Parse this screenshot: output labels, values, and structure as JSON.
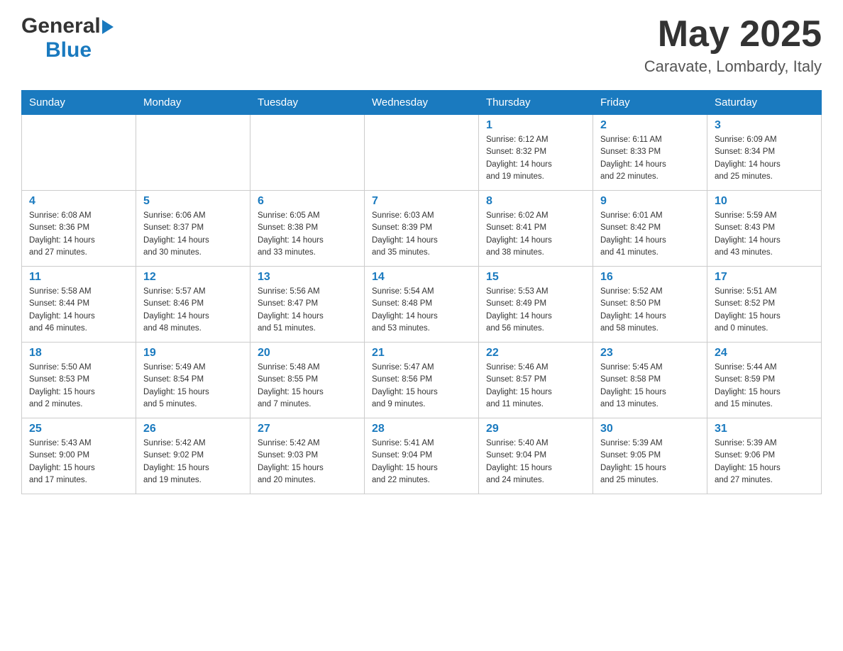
{
  "header": {
    "logo_general": "General",
    "logo_blue": "Blue",
    "month_year": "May 2025",
    "location": "Caravate, Lombardy, Italy"
  },
  "calendar": {
    "days_of_week": [
      "Sunday",
      "Monday",
      "Tuesday",
      "Wednesday",
      "Thursday",
      "Friday",
      "Saturday"
    ],
    "weeks": [
      [
        {
          "day": "",
          "info": ""
        },
        {
          "day": "",
          "info": ""
        },
        {
          "day": "",
          "info": ""
        },
        {
          "day": "",
          "info": ""
        },
        {
          "day": "1",
          "info": "Sunrise: 6:12 AM\nSunset: 8:32 PM\nDaylight: 14 hours\nand 19 minutes."
        },
        {
          "day": "2",
          "info": "Sunrise: 6:11 AM\nSunset: 8:33 PM\nDaylight: 14 hours\nand 22 minutes."
        },
        {
          "day": "3",
          "info": "Sunrise: 6:09 AM\nSunset: 8:34 PM\nDaylight: 14 hours\nand 25 minutes."
        }
      ],
      [
        {
          "day": "4",
          "info": "Sunrise: 6:08 AM\nSunset: 8:36 PM\nDaylight: 14 hours\nand 27 minutes."
        },
        {
          "day": "5",
          "info": "Sunrise: 6:06 AM\nSunset: 8:37 PM\nDaylight: 14 hours\nand 30 minutes."
        },
        {
          "day": "6",
          "info": "Sunrise: 6:05 AM\nSunset: 8:38 PM\nDaylight: 14 hours\nand 33 minutes."
        },
        {
          "day": "7",
          "info": "Sunrise: 6:03 AM\nSunset: 8:39 PM\nDaylight: 14 hours\nand 35 minutes."
        },
        {
          "day": "8",
          "info": "Sunrise: 6:02 AM\nSunset: 8:41 PM\nDaylight: 14 hours\nand 38 minutes."
        },
        {
          "day": "9",
          "info": "Sunrise: 6:01 AM\nSunset: 8:42 PM\nDaylight: 14 hours\nand 41 minutes."
        },
        {
          "day": "10",
          "info": "Sunrise: 5:59 AM\nSunset: 8:43 PM\nDaylight: 14 hours\nand 43 minutes."
        }
      ],
      [
        {
          "day": "11",
          "info": "Sunrise: 5:58 AM\nSunset: 8:44 PM\nDaylight: 14 hours\nand 46 minutes."
        },
        {
          "day": "12",
          "info": "Sunrise: 5:57 AM\nSunset: 8:46 PM\nDaylight: 14 hours\nand 48 minutes."
        },
        {
          "day": "13",
          "info": "Sunrise: 5:56 AM\nSunset: 8:47 PM\nDaylight: 14 hours\nand 51 minutes."
        },
        {
          "day": "14",
          "info": "Sunrise: 5:54 AM\nSunset: 8:48 PM\nDaylight: 14 hours\nand 53 minutes."
        },
        {
          "day": "15",
          "info": "Sunrise: 5:53 AM\nSunset: 8:49 PM\nDaylight: 14 hours\nand 56 minutes."
        },
        {
          "day": "16",
          "info": "Sunrise: 5:52 AM\nSunset: 8:50 PM\nDaylight: 14 hours\nand 58 minutes."
        },
        {
          "day": "17",
          "info": "Sunrise: 5:51 AM\nSunset: 8:52 PM\nDaylight: 15 hours\nand 0 minutes."
        }
      ],
      [
        {
          "day": "18",
          "info": "Sunrise: 5:50 AM\nSunset: 8:53 PM\nDaylight: 15 hours\nand 2 minutes."
        },
        {
          "day": "19",
          "info": "Sunrise: 5:49 AM\nSunset: 8:54 PM\nDaylight: 15 hours\nand 5 minutes."
        },
        {
          "day": "20",
          "info": "Sunrise: 5:48 AM\nSunset: 8:55 PM\nDaylight: 15 hours\nand 7 minutes."
        },
        {
          "day": "21",
          "info": "Sunrise: 5:47 AM\nSunset: 8:56 PM\nDaylight: 15 hours\nand 9 minutes."
        },
        {
          "day": "22",
          "info": "Sunrise: 5:46 AM\nSunset: 8:57 PM\nDaylight: 15 hours\nand 11 minutes."
        },
        {
          "day": "23",
          "info": "Sunrise: 5:45 AM\nSunset: 8:58 PM\nDaylight: 15 hours\nand 13 minutes."
        },
        {
          "day": "24",
          "info": "Sunrise: 5:44 AM\nSunset: 8:59 PM\nDaylight: 15 hours\nand 15 minutes."
        }
      ],
      [
        {
          "day": "25",
          "info": "Sunrise: 5:43 AM\nSunset: 9:00 PM\nDaylight: 15 hours\nand 17 minutes."
        },
        {
          "day": "26",
          "info": "Sunrise: 5:42 AM\nSunset: 9:02 PM\nDaylight: 15 hours\nand 19 minutes."
        },
        {
          "day": "27",
          "info": "Sunrise: 5:42 AM\nSunset: 9:03 PM\nDaylight: 15 hours\nand 20 minutes."
        },
        {
          "day": "28",
          "info": "Sunrise: 5:41 AM\nSunset: 9:04 PM\nDaylight: 15 hours\nand 22 minutes."
        },
        {
          "day": "29",
          "info": "Sunrise: 5:40 AM\nSunset: 9:04 PM\nDaylight: 15 hours\nand 24 minutes."
        },
        {
          "day": "30",
          "info": "Sunrise: 5:39 AM\nSunset: 9:05 PM\nDaylight: 15 hours\nand 25 minutes."
        },
        {
          "day": "31",
          "info": "Sunrise: 5:39 AM\nSunset: 9:06 PM\nDaylight: 15 hours\nand 27 minutes."
        }
      ]
    ]
  }
}
